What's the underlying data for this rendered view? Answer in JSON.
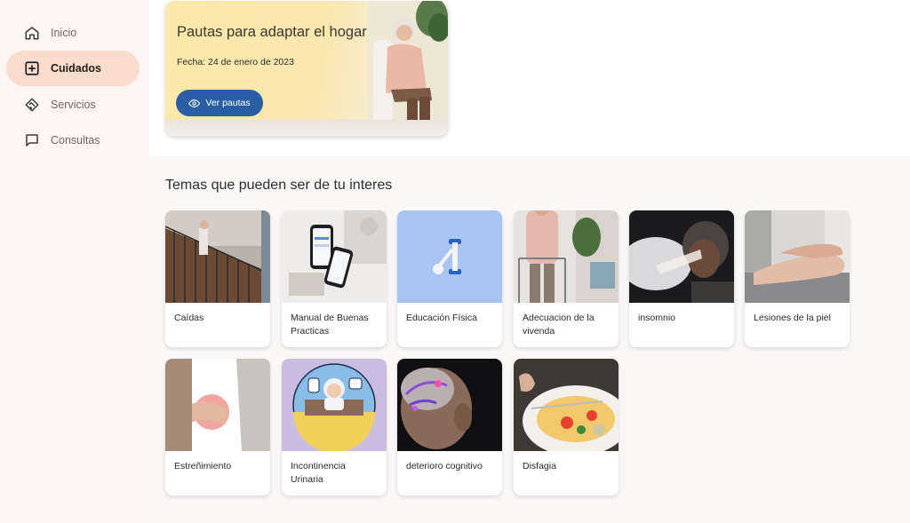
{
  "sidebar": {
    "items": [
      {
        "label": "Inicio",
        "icon": "home-icon",
        "active": false
      },
      {
        "label": "Cuidados",
        "icon": "plus-square-icon",
        "active": true
      },
      {
        "label": "Servicios",
        "icon": "handshake-icon",
        "active": false
      },
      {
        "label": "Consultas",
        "icon": "chat-icon",
        "active": false
      }
    ],
    "active_color": "#f8dccd"
  },
  "hero": {
    "title": "Pautas para adaptar el hogar",
    "date": "Fecha: 24 de enero de 2023",
    "button_label": "Ver pautas",
    "button_icon": "eye-icon",
    "button_color": "#2b5fa3"
  },
  "topics": {
    "title": "Temas que pueden ser de tu interes",
    "items": [
      {
        "label": "Caídas"
      },
      {
        "label": "Manual de Buenas Practicas"
      },
      {
        "label": "Educación Física"
      },
      {
        "label": "Adecuacion de la vivenda"
      },
      {
        "label": "insomnio"
      },
      {
        "label": "Lesiones de la piel"
      },
      {
        "label": "Estreñimiento"
      },
      {
        "label": "Incontinencia Urinaria"
      },
      {
        "label": "deterioro cognitivo"
      },
      {
        "label": "Disfagia"
      }
    ]
  }
}
